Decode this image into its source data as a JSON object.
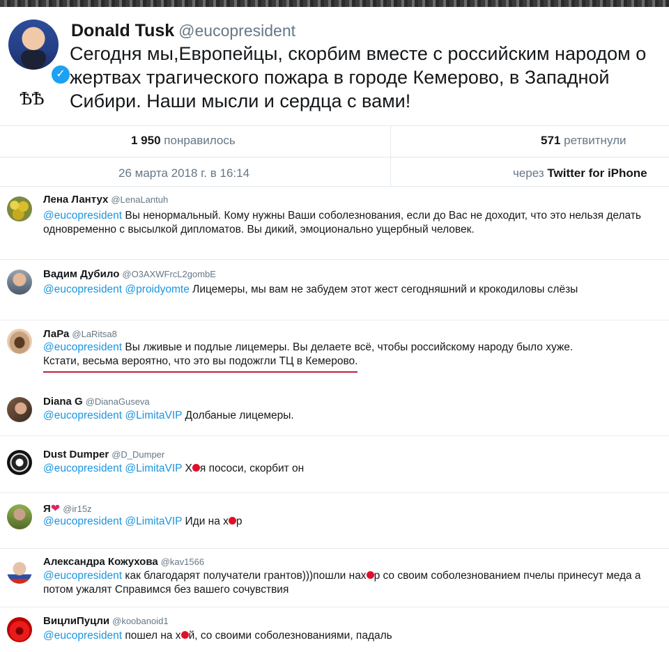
{
  "main": {
    "name": "Donald Tusk",
    "handle": "@eucopresident",
    "symbol": "ѢѢ",
    "text": "Сегодня мы,Европейцы, скорбим вместе с российским народом о жертвах трагического пожара в городе Кемерово, в Западной Сибири. Наши мысли и сердца с вами!",
    "likes_count": "1 950",
    "likes_label": "понравилось",
    "retweets_count": "571",
    "retweets_label": "ретвитнули",
    "date": "26 марта 2018 г. в 16:14",
    "via_label": "через",
    "via_client": "Twitter for iPhone"
  },
  "replies": [
    {
      "name": "Лена Лантух",
      "handle": "@LenaLantuh",
      "mention1": "@eucopresident",
      "text": " Вы ненормальный. Кому нужны Ваши соболезнования, если до Вас не доходит, что это нельзя делать одновременно с высылкой дипломатов. Вы дикий, эмоционально ущербный человек."
    },
    {
      "name": "Вадим Дубило",
      "handle": "@O3AXWFrcL2gombE",
      "mention1": "@eucopresident",
      "mention2": "@proidyomte",
      "text": " Лицемеры, мы вам не забудем этот жест сегодняшний и крокодиловы слёзы"
    },
    {
      "name": "ЛаРа",
      "handle": "@LaRitsa8",
      "mention1": "@eucopresident",
      "text": " Вы лживые и подлые лицемеры. Вы делаете всё, чтобы российскому народу было хуже.",
      "text2": "Кстати, весьма вероятно, что это вы подожгли ТЦ в Кемерово."
    },
    {
      "name": "Diana G",
      "handle": "@DianaGuseva",
      "mention1": "@eucopresident",
      "mention2": "@LimitaVIP",
      "text": " Долбаные лицемеры."
    },
    {
      "name": "Dust Dumper",
      "handle": "@D_Dumper",
      "mention1": "@eucopresident",
      "mention2": "@LimitaVIP",
      "text_a": " Х",
      "text_b": "я пососи, скорбит он"
    },
    {
      "name": "Я",
      "handle": "@ir15z",
      "mention1": "@eucopresident",
      "mention2": "@LimitaVIP",
      "text_a": " Иди на х",
      "text_b": "р"
    },
    {
      "name": "Александра Кожухова",
      "handle": "@kav1566",
      "mention1": "@eucopresident",
      "text_a": " как благодарят получатели грантов)))пошли нах",
      "text_b": "р со своим соболезнованием пчелы принесут меда а потом ужалят Справимся без вашего сочувствия"
    },
    {
      "name": "ВицлиПуцли",
      "handle": "@koobanoid1",
      "mention1": "@eucopresident",
      "text_a": " пошел на х",
      "text_b": "й, со своими соболезнованиями, падаль"
    }
  ],
  "colors": {
    "mention": "#1b95e0",
    "verified": "#1da1f2",
    "underline": "#c41b3c",
    "redaction": "#e0102a"
  },
  "icons": [
    "verified-badge-icon",
    "heart-icon"
  ]
}
